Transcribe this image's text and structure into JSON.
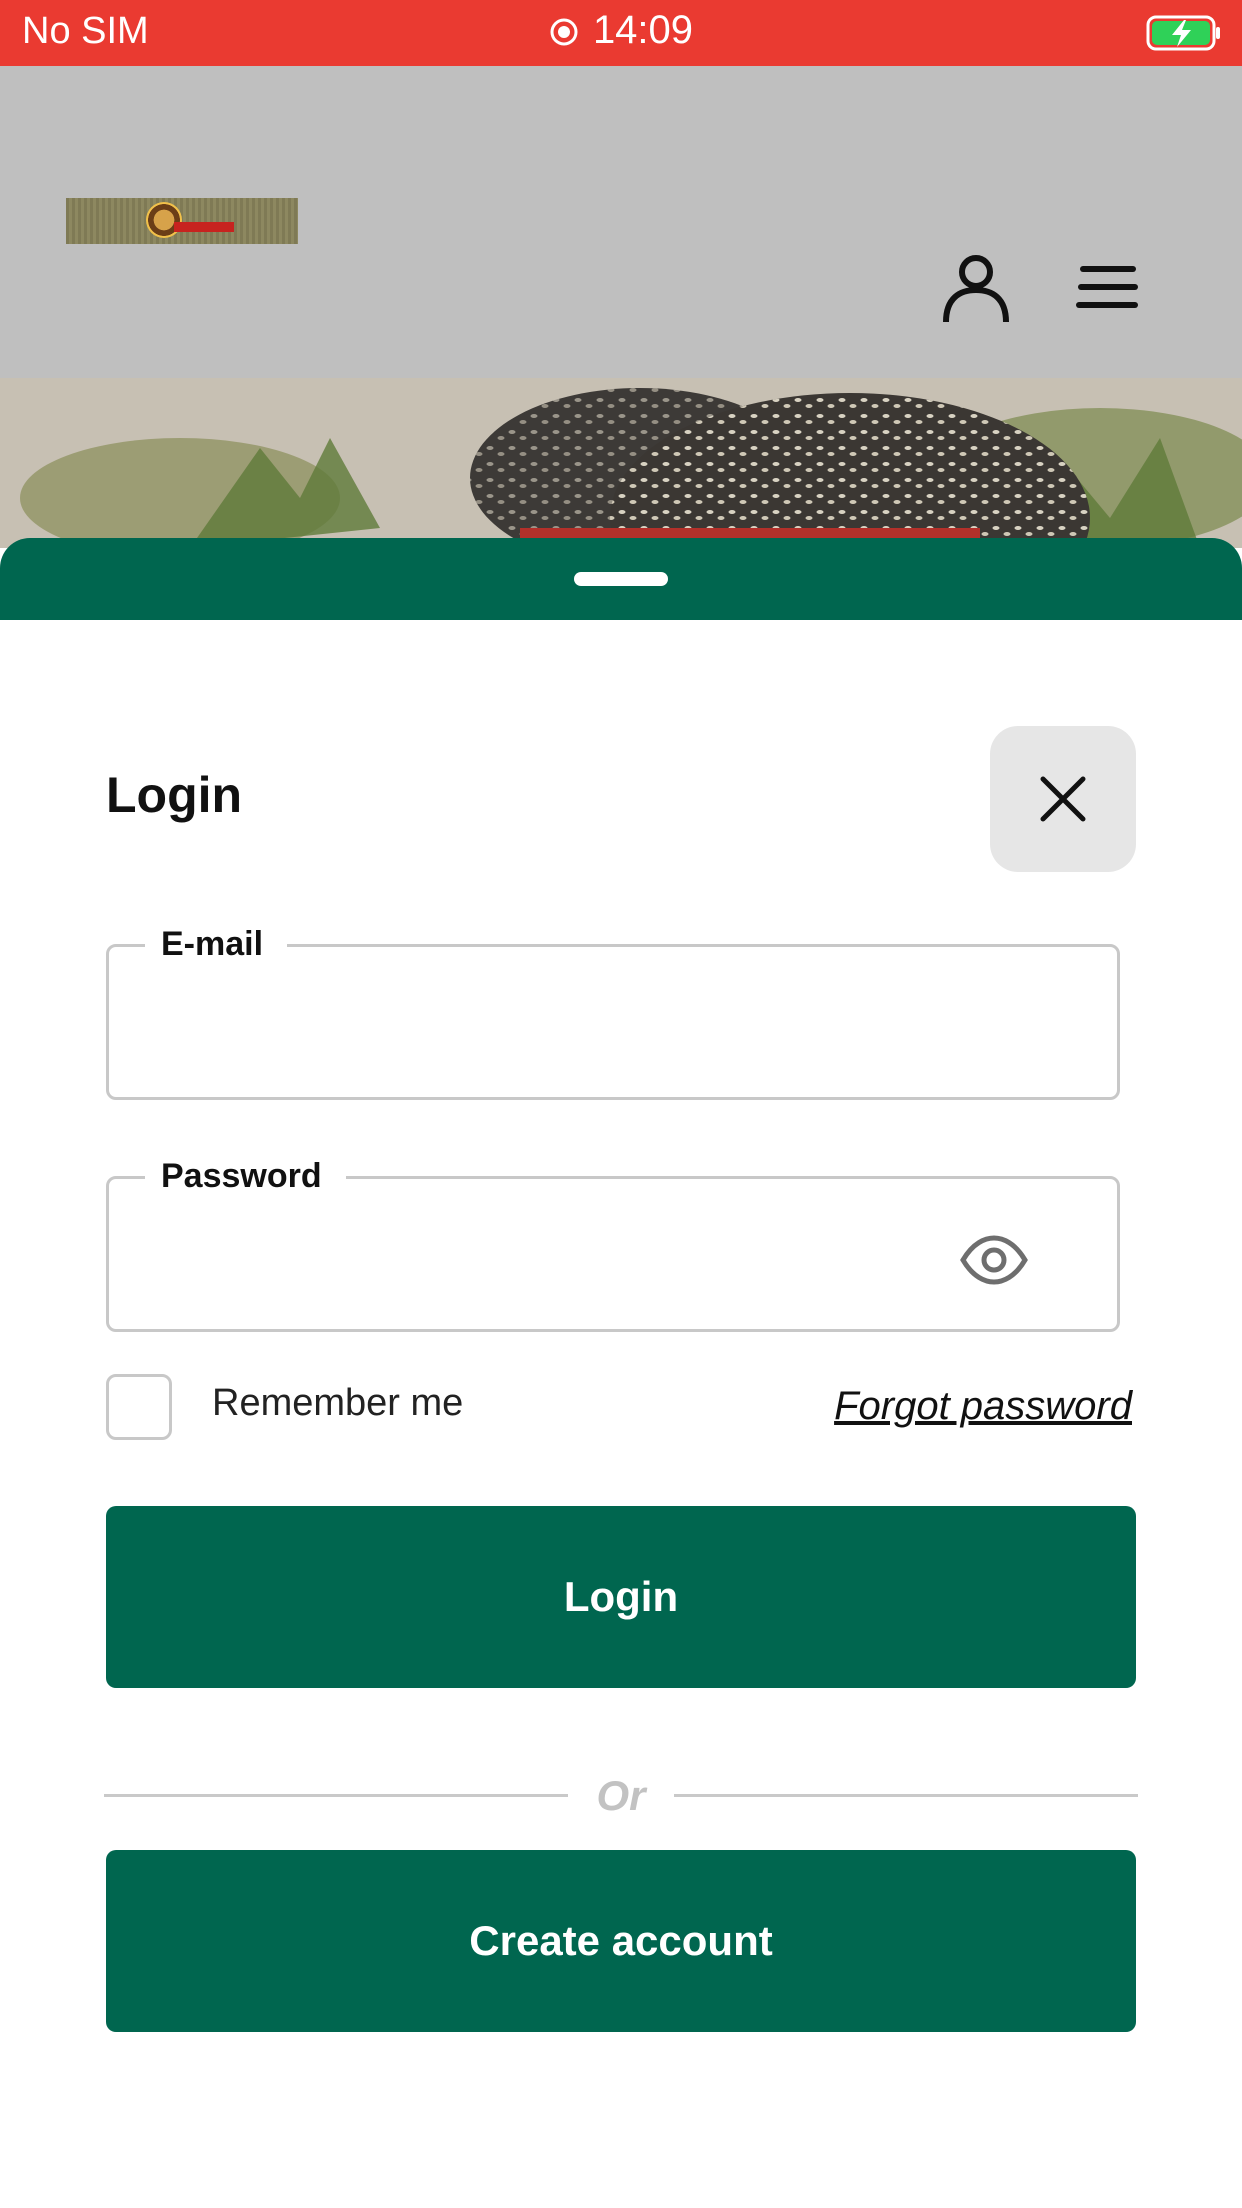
{
  "status_bar": {
    "carrier": "No SIM",
    "time": "14:09",
    "bar_color": "#ea3a31",
    "icons": [
      "recording-icon",
      "battery-charging-icon"
    ]
  },
  "header": {
    "logo_alt": "restaurant-logo",
    "icons": [
      "user-icon",
      "hamburger-menu-icon"
    ]
  },
  "hero": {
    "image": "burger-photo"
  },
  "login_form": {
    "title": "Login",
    "close_icon": "close-icon",
    "email": {
      "label": "E-mail",
      "value": "",
      "placeholder": ""
    },
    "password": {
      "label": "Password",
      "value": "",
      "placeholder": "",
      "toggle_icon": "eye-icon"
    },
    "remember_me": {
      "label": "Remember me",
      "checked": false
    },
    "forgot_password": "Forgot password",
    "login_button": "Login",
    "divider_text": "Or",
    "create_account_button": "Create account"
  },
  "colors": {
    "brand_green": "#00664f",
    "status_red": "#ea3a31",
    "header_gray": "#bfbfbf",
    "border_gray": "#c8c8c8"
  }
}
